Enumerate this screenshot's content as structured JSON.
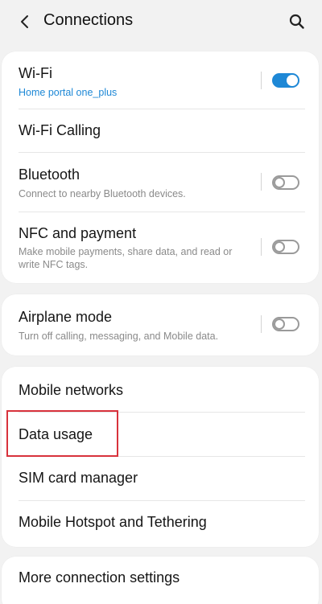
{
  "header": {
    "title": "Connections",
    "back_icon": "back-arrow-icon",
    "search_icon": "search-icon"
  },
  "groups": [
    {
      "items": [
        {
          "title": "Wi-Fi",
          "subtitle": "Home portal one_plus",
          "toggle": "on"
        },
        {
          "title": "Wi-Fi Calling"
        },
        {
          "title": "Bluetooth",
          "subtitle": "Connect to nearby Bluetooth devices.",
          "toggle": "off"
        },
        {
          "title": "NFC and payment",
          "subtitle": "Make mobile payments, share data, and read or write NFC tags.",
          "toggle": "off"
        }
      ]
    },
    {
      "items": [
        {
          "title": "Airplane mode",
          "subtitle": "Turn off calling, messaging, and Mobile data.",
          "toggle": "off"
        }
      ]
    },
    {
      "items": [
        {
          "title": "Mobile networks"
        },
        {
          "title": "Data usage"
        },
        {
          "title": "SIM card manager"
        },
        {
          "title": "Mobile Hotspot and Tethering"
        }
      ]
    },
    {
      "items": [
        {
          "title": "More connection settings"
        }
      ]
    }
  ],
  "colors": {
    "accent": "#1e88d6",
    "highlight": "#d8323c",
    "background": "#f2f2f2"
  }
}
